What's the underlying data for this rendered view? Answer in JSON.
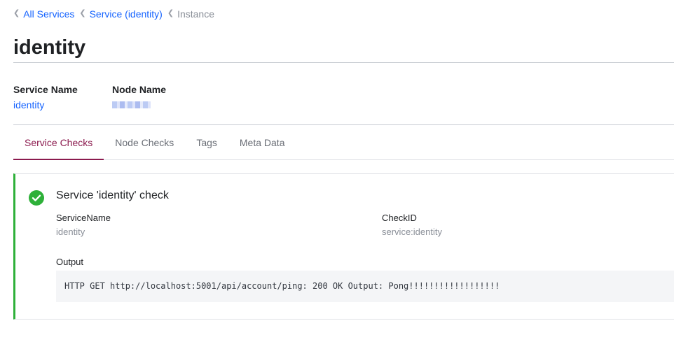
{
  "breadcrumb": {
    "items": [
      {
        "label": "All Services"
      },
      {
        "label": "Service (identity)"
      },
      {
        "label": "Instance"
      }
    ]
  },
  "page": {
    "title": "identity"
  },
  "info": {
    "service_name_label": "Service Name",
    "service_name_value": "identity",
    "node_name_label": "Node Name"
  },
  "tabs": [
    {
      "label": "Service Checks",
      "active": true
    },
    {
      "label": "Node Checks",
      "active": false
    },
    {
      "label": "Tags",
      "active": false
    },
    {
      "label": "Meta Data",
      "active": false
    }
  ],
  "check": {
    "status": "passing",
    "status_color": "#2eb039",
    "status_icon": "check-circle-icon",
    "title": "Service 'identity' check",
    "service_name_label": "ServiceName",
    "service_name_value": "identity",
    "check_id_label": "CheckID",
    "check_id_value": "service:identity",
    "output_label": "Output",
    "output_text": "HTTP GET http://localhost:5001/api/account/ping: 200 OK Output: Pong!!!!!!!!!!!!!!!!!!"
  },
  "colors": {
    "link": "#1563ff",
    "active_tab": "#8b1a4e",
    "passing": "#2eb039"
  }
}
